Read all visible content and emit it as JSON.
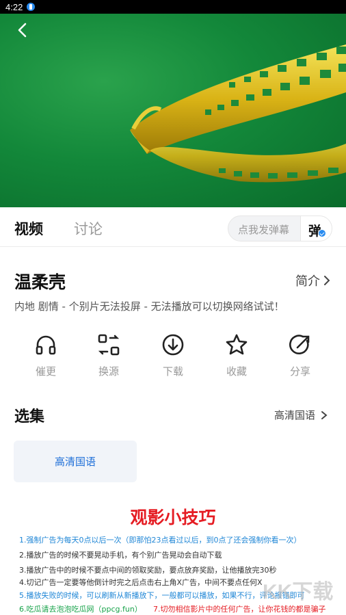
{
  "status": {
    "time": "4:22"
  },
  "tabs": [
    "视频",
    "讨论"
  ],
  "danmu": {
    "placeholder": "点我发弹幕",
    "button": "弹"
  },
  "video": {
    "title": "温柔壳",
    "intro_label": "简介",
    "meta": "内地  剧情 - 个别片无法投屏 - 无法播放可以切换网络试试！"
  },
  "actions": [
    {
      "label": "催更",
      "icon": "headphones-icon"
    },
    {
      "label": "换源",
      "icon": "switch-source-icon"
    },
    {
      "label": "下载",
      "icon": "download-icon"
    },
    {
      "label": "收藏",
      "icon": "star-icon"
    },
    {
      "label": "分享",
      "icon": "share-icon"
    }
  ],
  "episodes": {
    "title": "选集",
    "selected_quality": "高清国语",
    "items": [
      "高清国语"
    ]
  },
  "tips": {
    "title": "观影小技巧",
    "lines": [
      {
        "text": "1.强制广告为每天0点以后一次（即那怕23点看过以后，到0点了还会强制你看一次）",
        "color": "#1f86d6"
      },
      {
        "text": "2.播放广告的时候不要晃动手机，有个别广告晃动会自动下载",
        "color": "#333333"
      },
      {
        "text": "3.播放广告中的时候不要点中间的领取奖励，要点放弃奖励，让他播放完30秒",
        "color": "#333333"
      },
      {
        "text": "4.切记广告一定要等他倒计时完之后点击右上角X广告，中间不要点任何X",
        "color": "#333333"
      },
      {
        "text": "5.播放失败的时候，可以刷新从新播放下，一般都可以播放，如果不行，评论报错即可",
        "color": "#1f86d6"
      }
    ],
    "last_line_a": {
      "text": "6.吃瓜请去泡泡吃瓜网（ppcg.fun）",
      "color": "#17a34a"
    },
    "last_line_b": {
      "text": "7.切勿相信影片中的任何广告，让你花钱的都是骗子",
      "color": "#e51c23"
    }
  },
  "watermark": "KK下载"
}
